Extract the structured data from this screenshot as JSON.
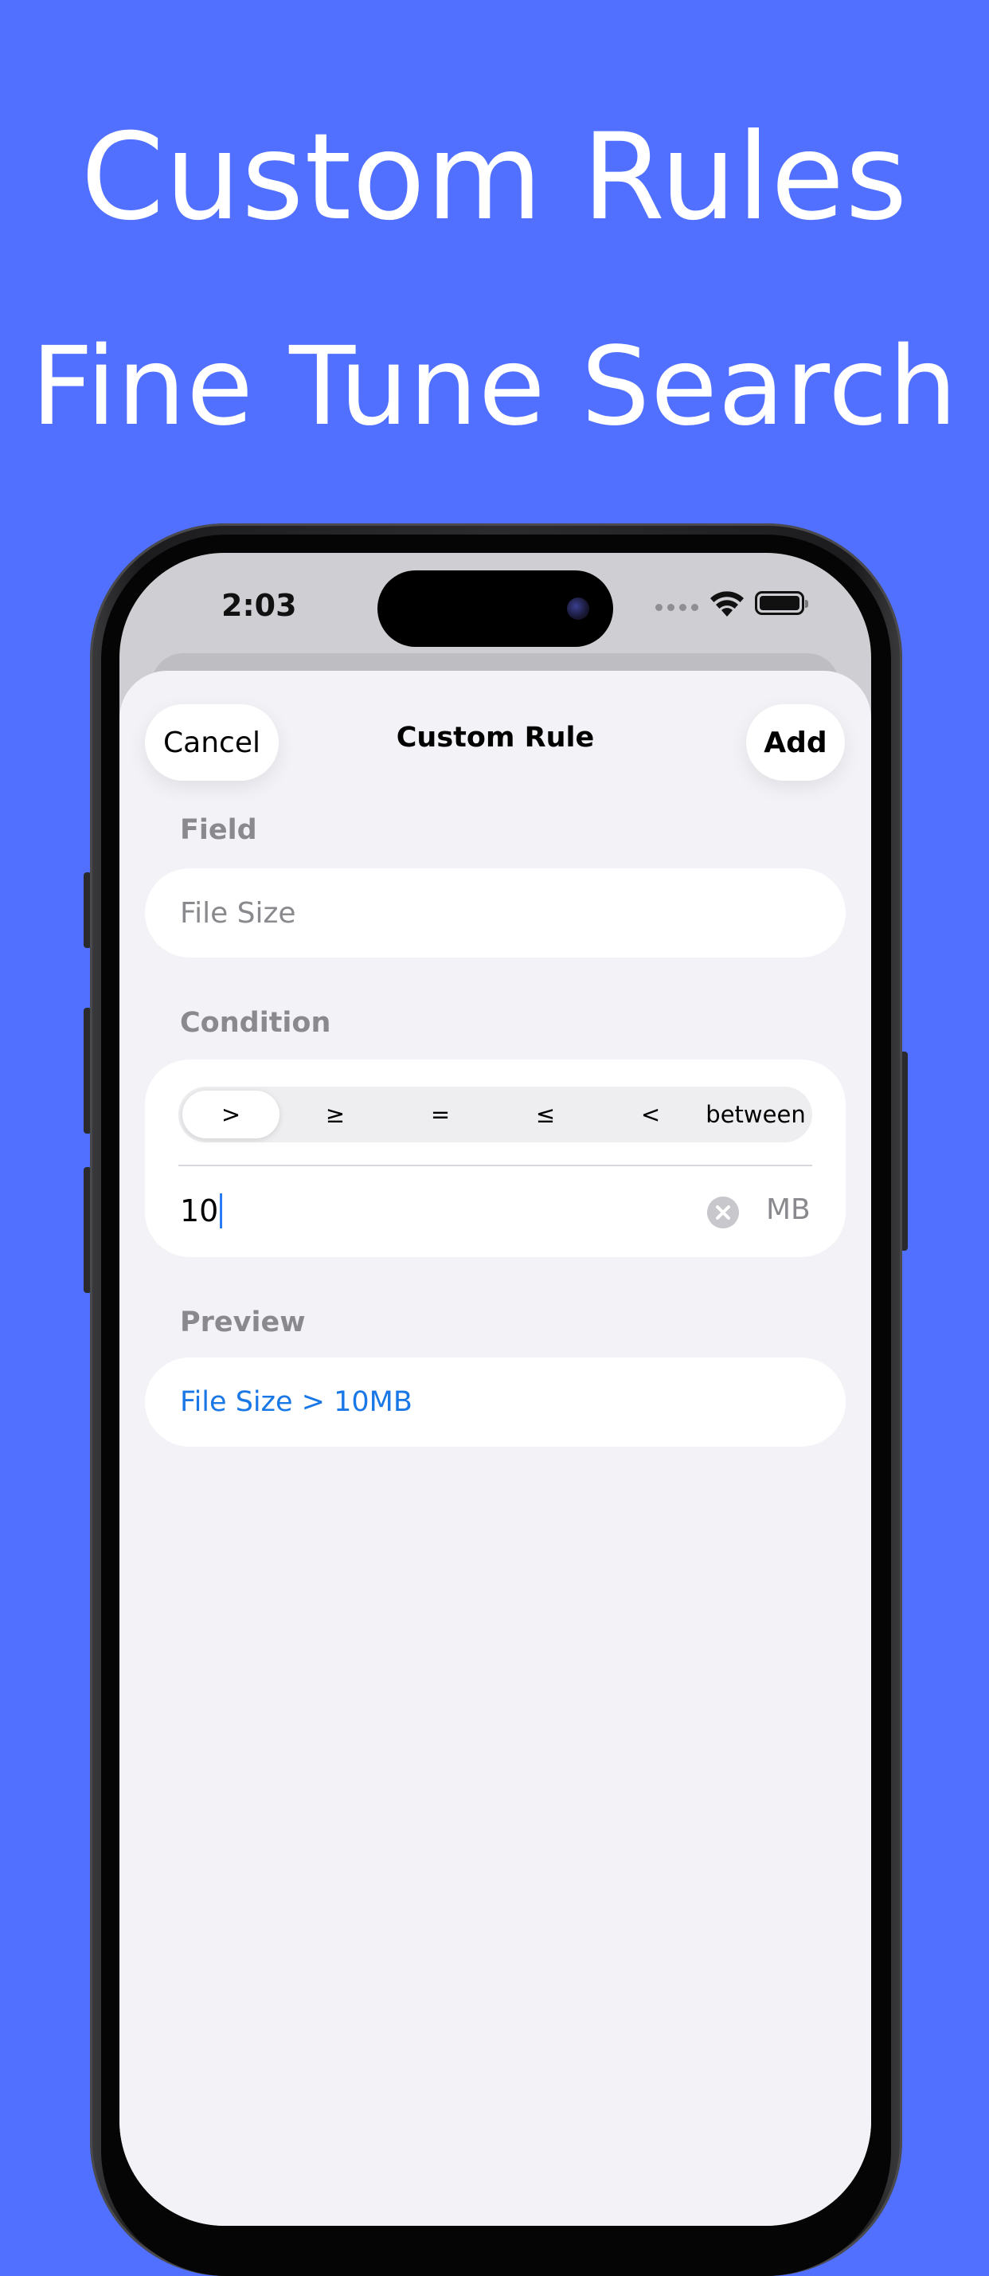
{
  "hero": {
    "line1": "Custom Rules",
    "line2": "Fine Tune Search"
  },
  "status_bar": {
    "time": "2:03",
    "icons": [
      "signal-dots-icon",
      "wifi-icon",
      "battery-icon"
    ]
  },
  "nav": {
    "cancel_label": "Cancel",
    "title": "Custom Rule",
    "add_label": "Add"
  },
  "field_section": {
    "label": "Field",
    "value": "File Size"
  },
  "condition_section": {
    "label": "Condition",
    "operators": [
      ">",
      "≥",
      "=",
      "≤",
      "<",
      "between"
    ],
    "selected_operator": ">",
    "amount": "10",
    "unit": "MB"
  },
  "preview_section": {
    "label": "Preview",
    "text": "File Size > 10MB"
  },
  "colors": {
    "background": "#5170FF",
    "sheet": "#F2F2F7",
    "accent": "#1A78E6",
    "secondary_text": "#8A8A8E"
  }
}
